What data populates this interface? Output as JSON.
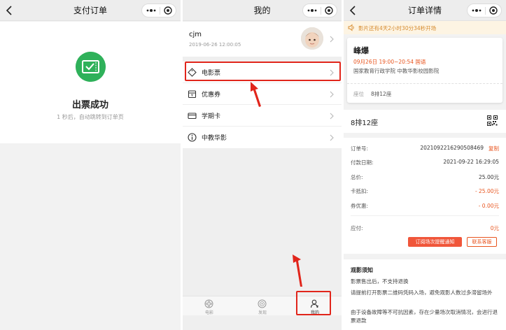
{
  "panel1": {
    "nav_title": "支付订单",
    "success_title": "出票成功",
    "success_subtitle": "1 秒后，自动跳转到订单页"
  },
  "panel2": {
    "nav_title": "我的",
    "profile": {
      "name": "cjm",
      "date": "2019-06-26 12:00:05"
    },
    "menu": [
      {
        "label": "电影票",
        "icon": "ticket-icon"
      },
      {
        "label": "优惠券",
        "icon": "coupon-icon"
      },
      {
        "label": "学期卡",
        "icon": "card-icon"
      },
      {
        "label": "中教华影",
        "icon": "info-icon"
      }
    ],
    "tabs": [
      {
        "label": "电影",
        "icon": "film-reel-icon"
      },
      {
        "label": "发现",
        "icon": "discover-icon"
      },
      {
        "label": "我的",
        "icon": "user-icon"
      }
    ]
  },
  "panel3": {
    "nav_title": "订单详情",
    "notice": "影片还有4天2小时30分34秒开场",
    "movie": {
      "title": "峰爆",
      "time": "09月26日 19:00~20:54 国语",
      "venue": "国家教育行政学院 中教华影校园影院",
      "seat_label": "座位",
      "seat_value": "8排12座"
    },
    "seat_big": "8排12座",
    "order_rows": [
      {
        "label": "订单号:",
        "value": "2021092216290508469",
        "action": "复制"
      },
      {
        "label": "付款日期:",
        "value": "2021-09-22 16:29:05"
      },
      {
        "label": "总价:",
        "value": "25.00元"
      },
      {
        "label": "卡抵扣:",
        "value": "- 25.00元"
      },
      {
        "label": "券优惠:",
        "value": "- 0.00元"
      },
      {
        "label": "应付:",
        "value": "0元"
      }
    ],
    "buttons": {
      "notify": "订阅场次提醒通知",
      "service": "联系客服"
    },
    "rules_title": "观影须知",
    "rules": [
      "影票售出后，不支持退换",
      "请提前打开影票二维码凭码入场，避免观影人数过多滞留场外",
      "由于设备故障等不可抗因素，存在少量场次取消情况，会进行退票退款"
    ]
  },
  "colors": {
    "success_green": "#2fb15a",
    "accent_orange": "#e8541e",
    "highlight_red": "#e1251b",
    "notice_bg": "#fdf4e3"
  }
}
